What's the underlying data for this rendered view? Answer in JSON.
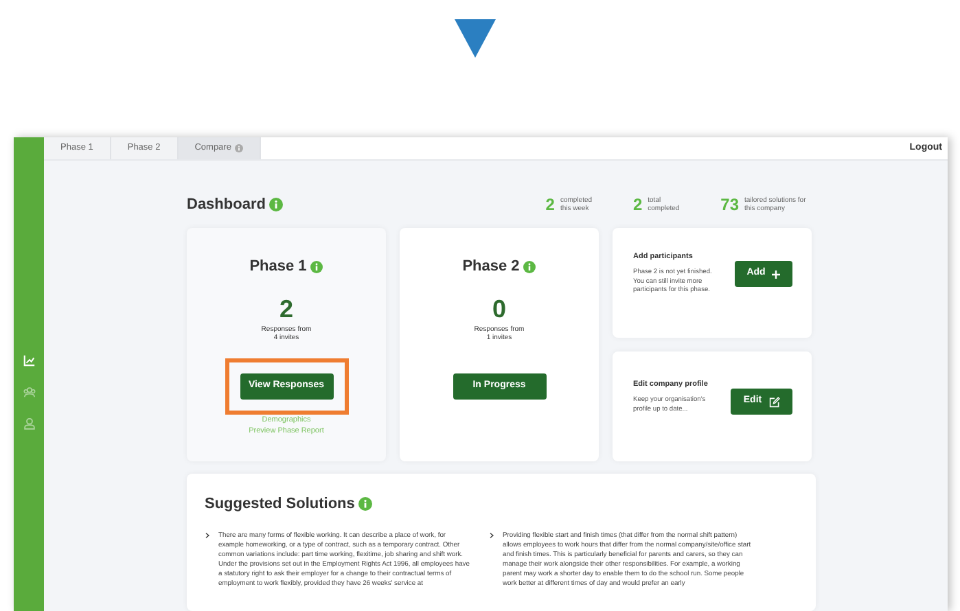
{
  "sidebar": {
    "items": [
      {
        "kind": "chart",
        "selected": true
      },
      {
        "kind": "group",
        "selected": false
      },
      {
        "kind": "person",
        "selected": false
      }
    ]
  },
  "tabs": [
    {
      "label": "Phase 1",
      "selected": false,
      "info": false
    },
    {
      "label": "Phase 2",
      "selected": false,
      "info": false
    },
    {
      "label": "Compare",
      "selected": true,
      "info": true
    }
  ],
  "logout": "Logout",
  "dashboard": {
    "title": "Dashboard",
    "stats": [
      {
        "value": "2",
        "label": "completed this week"
      },
      {
        "value": "2",
        "label": "total completed"
      },
      {
        "value": "73",
        "label": "tailored solutions for this company"
      }
    ]
  },
  "phases": [
    {
      "title": "Phase 1",
      "count": "2",
      "caption": "Responses from 4 invites",
      "button": "View Responses",
      "highlighted": true,
      "links": [
        "Demographics",
        "Preview Phase Report"
      ]
    },
    {
      "title": "Phase 2",
      "count": "0",
      "caption": "Responses from 1 invites",
      "button": "In Progress",
      "highlighted": false
    }
  ],
  "actions": [
    {
      "title": "Add participants",
      "text": "Phase 2 is not yet finished. You can still invite more participants for this phase.",
      "button": "Add",
      "kind": "add"
    },
    {
      "title": "Edit company profile",
      "text": "Keep your organisation's profile up to date...",
      "button": "Edit",
      "kind": "edit"
    }
  ],
  "solutions": {
    "title": "Suggested Solutions",
    "items": [
      "There are many forms of flexible working. It can describe a place of work, for example homeworking, or a type of contract, such as a temporary contract. Other common variations include: part time working, flexitime, job sharing and shift work. Under the provisions set out in the Employment Rights Act 1996, all employees have a statutory right to ask their employer for a change to their contractual terms of employment to work flexibly, provided they have 26 weeks' service at",
      "Providing flexible start and finish times (that differ from the normal shift pattern) allows employees to work hours that differ from the normal company/site/office start and finish times. This is particularly beneficial for parents and carers, so they can manage their work alongside their other responsibilities. For example, a working parent may work a shorter day to enable them to do the school run. Some people work better at different times of day and would prefer an early"
    ]
  }
}
